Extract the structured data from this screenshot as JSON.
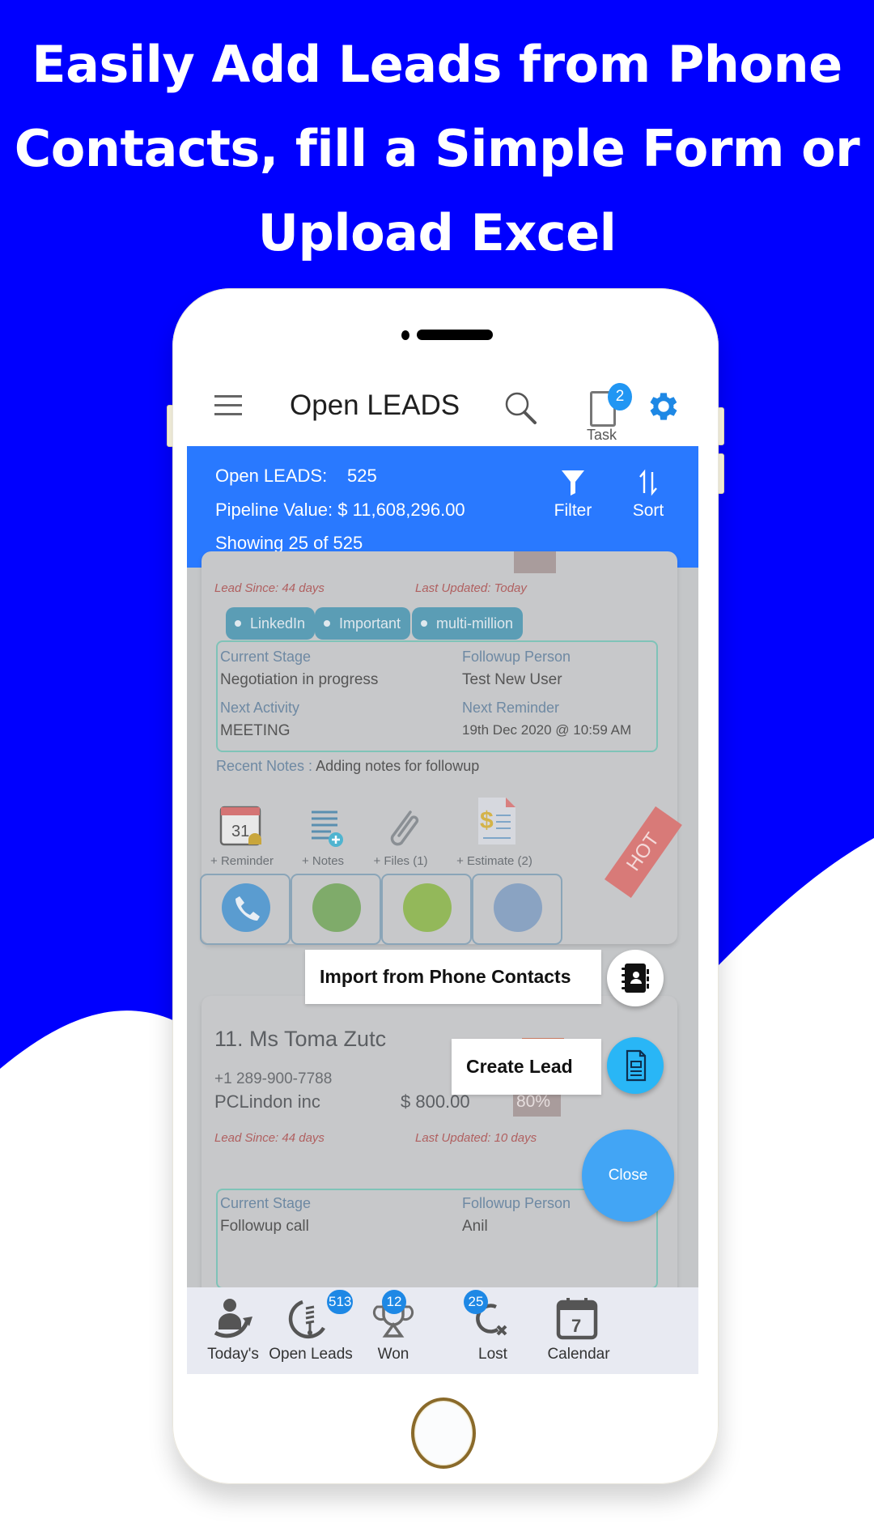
{
  "promo": {
    "headline_lines": [
      "Easily Add Leads from Phone",
      "Contacts, fill a Simple Form or",
      "Upload Excel"
    ],
    "background_color": "#0000ff"
  },
  "app_bar": {
    "title": "Open LEADS",
    "task_label": "Task",
    "task_badge": "2",
    "icons": [
      "menu-icon",
      "search-icon",
      "task-clipboard-icon",
      "gear-icon"
    ]
  },
  "summary": {
    "open_leads_label": "Open LEADS:",
    "open_leads_value": "525",
    "pipeline_label": "Pipeline Value:",
    "pipeline_value": "$ 11,608,296.00",
    "showing": "Showing 25 of 525",
    "filter_label": "Filter",
    "sort_label": "Sort",
    "accent_color": "#2979ff"
  },
  "leads": [
    {
      "lead_since": "Lead Since: 44 days",
      "last_updated": "Last Updated: Today",
      "tags": [
        "LinkedIn",
        "Important",
        "multi-million"
      ],
      "current_stage_label": "Current Stage",
      "current_stage": "Negotiation in progress",
      "followup_person_label": "Followup Person",
      "followup_person": "Test New User",
      "next_activity_label": "Next Activity",
      "next_activity": "MEETING",
      "next_reminder_label": "Next Reminder",
      "next_reminder": "19th Dec 2020 @ 10:59 AM",
      "recent_notes_label": "Recent Notes :",
      "recent_notes": "Adding notes for followup",
      "actions": [
        {
          "icon": "calendar-reminder-icon",
          "label": "+ Reminder",
          "calendar_day": "31"
        },
        {
          "icon": "notes-icon",
          "label": "+ Notes"
        },
        {
          "icon": "paperclip-icon",
          "label": "+ Files (1)"
        },
        {
          "icon": "estimate-icon",
          "label": "+ Estimate (2)"
        }
      ],
      "contact_buttons": [
        "phone-call-icon",
        "whatsapp-icon",
        "sms-icon",
        "email-icon"
      ],
      "ribbon": "HOT"
    },
    {
      "title": "11. Ms Toma Zutc",
      "phone": "+1 289-900-7788",
      "company": "PCLindon inc",
      "amount": "$ 800.00",
      "probability": "80%",
      "lead_since": "Lead Since: 44 days",
      "last_updated": "Last Updated: 10 days",
      "current_stage_label": "Current Stage",
      "current_stage": "Followup call",
      "followup_person_label": "Followup Person",
      "followup_person": "Anil"
    }
  ],
  "fab_menu": {
    "import_label": "Import from Phone Contacts",
    "create_label": "Create Lead",
    "close_label": "Close"
  },
  "bottom_nav": [
    {
      "label": "Today's",
      "icon": "todays-user-icon",
      "badge": ""
    },
    {
      "label": "Open Leads",
      "icon": "open-leads-icon",
      "badge": "513"
    },
    {
      "label": "Won",
      "icon": "trophy-icon",
      "badge": "12"
    },
    {
      "label": "Lost",
      "icon": "lost-icon",
      "badge": "25"
    },
    {
      "label": "Calendar",
      "icon": "calendar-icon",
      "badge": "",
      "calendar_day": "7"
    }
  ]
}
